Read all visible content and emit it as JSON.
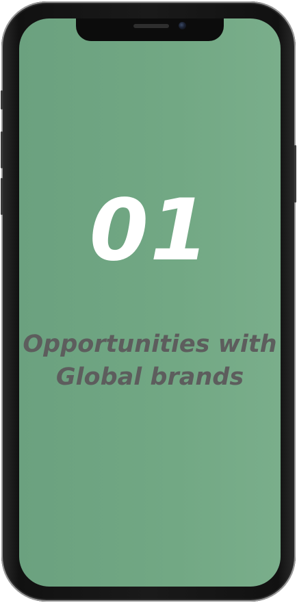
{
  "slide": {
    "number": "01",
    "headline_line1": "Opportunities with",
    "headline_line2": "Global brands"
  },
  "colors": {
    "screen_background": "#72a884",
    "number_text": "#ffffff",
    "headline_text": "#5d5d5d",
    "device_frame": "#111111"
  },
  "icons": {
    "front_camera": "camera-icon",
    "earpiece": "speaker-icon"
  }
}
